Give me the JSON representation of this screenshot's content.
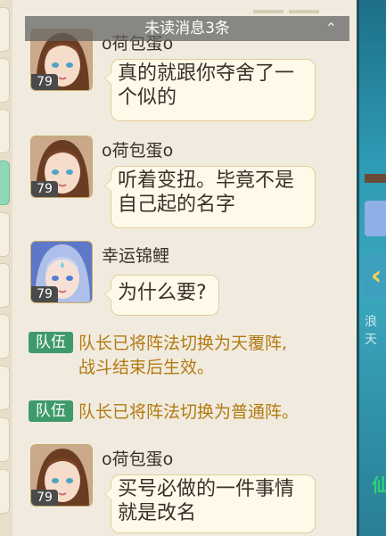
{
  "banner": {
    "unread_text": "未读消息3条"
  },
  "messages": [
    {
      "sender": "o荷包蛋o",
      "level": "79",
      "lines": [
        "真的就跟你夺舍了一",
        "个似的"
      ]
    },
    {
      "sender": "o荷包蛋o",
      "level": "79",
      "lines": [
        "听着变扭。毕竟不是",
        "自己起的名字"
      ]
    },
    {
      "sender": "幸运锦鲤",
      "level": "79",
      "lines": [
        "为什么要?"
      ]
    },
    {
      "sender": "o荷包蛋o",
      "level": "79",
      "lines": [
        "买号必做的一件事情",
        "就是改名"
      ]
    }
  ],
  "system_messages": [
    {
      "badge": "队伍",
      "line1": "队长已将阵法切换为天覆阵,",
      "line2": "战斗结束后生效。"
    },
    {
      "badge": "队伍",
      "line1": "队长已将阵法切换为普通阵。"
    }
  ],
  "scene": {
    "side_text_1": "浪天",
    "side_text_2": "仙"
  },
  "colors": {
    "system_text": "#b27a12",
    "badge_bg": "#3f9a6b",
    "bubble_bg": "#fff9ea",
    "bubble_border": "#e3cc98"
  }
}
